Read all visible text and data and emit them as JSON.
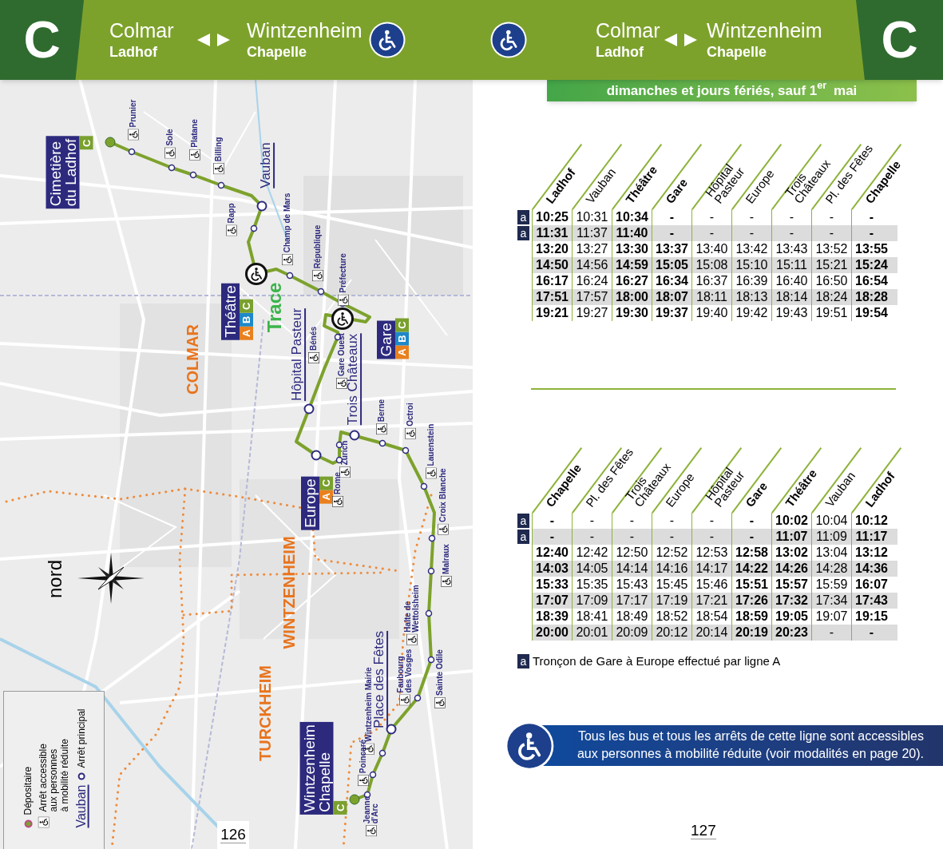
{
  "header": {
    "line_letters": [
      "C",
      "C"
    ],
    "sides": [
      {
        "from_city": "Colmar",
        "from_stop": "Ladhof",
        "to_city": "Wintzenheim",
        "to_stop": "Chapelle"
      },
      {
        "from_city": "Colmar",
        "from_stop": "Ladhof",
        "to_city": "Wintzenheim",
        "to_stop": "Chapelle"
      }
    ]
  },
  "map": {
    "main_stops": [
      {
        "name": "Cimetière\ndu Ladhof",
        "kind": "boxed",
        "lines": [
          {
            "letter": "C",
            "color": "#7aa02e"
          }
        ]
      },
      {
        "name": "Vauban",
        "kind": "underlined"
      },
      {
        "name": "Théâtre",
        "kind": "boxed",
        "lines": [
          {
            "letter": "A",
            "color": "#e8801e"
          },
          {
            "letter": "B",
            "color": "#1e88c8"
          },
          {
            "letter": "C",
            "color": "#7aa02e"
          }
        ]
      },
      {
        "name": "Hôpital Pasteur",
        "kind": "underlined"
      },
      {
        "name": "Trois Châteaux",
        "kind": "underlined"
      },
      {
        "name": "Gare",
        "kind": "boxed",
        "lines": [
          {
            "letter": "A",
            "color": "#e8801e"
          },
          {
            "letter": "B",
            "color": "#1e88c8"
          },
          {
            "letter": "C",
            "color": "#7aa02e"
          }
        ]
      },
      {
        "name": "Europe",
        "kind": "boxed",
        "lines": [
          {
            "letter": "A",
            "color": "#e8801e"
          },
          {
            "letter": "C",
            "color": "#7aa02e"
          }
        ]
      },
      {
        "name": "Place des Fêtes",
        "kind": "underlined"
      },
      {
        "name": "Wintzenheim\nChapelle",
        "kind": "boxed",
        "lines": [
          {
            "letter": "C",
            "color": "#7aa02e"
          }
        ]
      }
    ],
    "stops": [
      "Prunier",
      "Sole",
      "Platane",
      "Billing",
      "Rapp",
      "Champ de Mars",
      "République",
      "Préfecture",
      "Bénés",
      "Gare Ouest",
      "Berne",
      "Octroi",
      "Lauenstein",
      "Zurich",
      "Rome",
      "Croix Blanche",
      "Malraux",
      "Halte de\nWettolsheim",
      "Sainte Odile",
      "Faubourg\ndes Vosges",
      "Wintzenheim Mairie",
      "Poincaré",
      "Jeanne\nd'Arc"
    ],
    "towns": [
      "COLMAR",
      "WINTZENHEIM",
      "TURCKHEIM"
    ],
    "agency": "Trace",
    "compass": "nord",
    "legend": {
      "depot": "Dépositaire",
      "accessible": "Arrêt accessible\naux personnes\nà mobilité réduite",
      "sample": "Vauban",
      "main": "Arrêt principal"
    }
  },
  "day_banner": "dimanches et jours fériés, sauf 1$^{er}$ mai",
  "outbound": {
    "columns": [
      {
        "label": "Ladhof",
        "bold": true
      },
      {
        "label": "Vauban",
        "bold": false
      },
      {
        "label": "Théâtre",
        "bold": true
      },
      {
        "label": "Gare",
        "bold": true
      },
      {
        "label": "Hôpital\nPasteur",
        "bold": false
      },
      {
        "label": "Europe",
        "bold": false
      },
      {
        "label": "Trois\nChâteaux",
        "bold": false
      },
      {
        "label": "Pl. des Fêtes",
        "bold": false
      },
      {
        "label": "Chapelle",
        "bold": true
      }
    ],
    "rows": [
      {
        "note": "a",
        "shaded": false,
        "times": [
          "10:25",
          "10:31",
          "10:34",
          "-",
          "-",
          "-",
          "-",
          "-",
          "-"
        ]
      },
      {
        "note": "a",
        "shaded": true,
        "times": [
          "11:31",
          "11:37",
          "11:40",
          "-",
          "-",
          "-",
          "-",
          "-",
          "-"
        ]
      },
      {
        "shaded": false,
        "times": [
          "13:20",
          "13:27",
          "13:30",
          "13:37",
          "13:40",
          "13:42",
          "13:43",
          "13:52",
          "13:55"
        ]
      },
      {
        "shaded": true,
        "times": [
          "14:50",
          "14:56",
          "14:59",
          "15:05",
          "15:08",
          "15:10",
          "15:11",
          "15:21",
          "15:24"
        ]
      },
      {
        "shaded": false,
        "times": [
          "16:17",
          "16:24",
          "16:27",
          "16:34",
          "16:37",
          "16:39",
          "16:40",
          "16:50",
          "16:54"
        ]
      },
      {
        "shaded": true,
        "times": [
          "17:51",
          "17:57",
          "18:00",
          "18:07",
          "18:11",
          "18:13",
          "18:14",
          "18:24",
          "18:28"
        ]
      },
      {
        "shaded": false,
        "times": [
          "19:21",
          "19:27",
          "19:30",
          "19:37",
          "19:40",
          "19:42",
          "19:43",
          "19:51",
          "19:54"
        ]
      }
    ]
  },
  "return": {
    "columns": [
      {
        "label": "Chapelle",
        "bold": true
      },
      {
        "label": "Pl. des Fêtes",
        "bold": false
      },
      {
        "label": "Trois\nChâteaux",
        "bold": false
      },
      {
        "label": "Europe",
        "bold": false
      },
      {
        "label": "Hôpital\nPasteur",
        "bold": false
      },
      {
        "label": "Gare",
        "bold": true
      },
      {
        "label": "Théâtre",
        "bold": true
      },
      {
        "label": "Vauban",
        "bold": false
      },
      {
        "label": "Ladhof",
        "bold": true
      }
    ],
    "rows": [
      {
        "note": "a",
        "shaded": false,
        "times": [
          "-",
          "-",
          "-",
          "-",
          "-",
          "-",
          "10:02",
          "10:04",
          "10:12"
        ]
      },
      {
        "note": "a",
        "shaded": true,
        "times": [
          "-",
          "-",
          "-",
          "-",
          "-",
          "-",
          "11:07",
          "11:09",
          "11:17"
        ]
      },
      {
        "shaded": false,
        "times": [
          "12:40",
          "12:42",
          "12:50",
          "12:52",
          "12:53",
          "12:58",
          "13:02",
          "13:04",
          "13:12"
        ]
      },
      {
        "shaded": true,
        "times": [
          "14:03",
          "14:05",
          "14:14",
          "14:16",
          "14:17",
          "14:22",
          "14:26",
          "14:28",
          "14:36"
        ]
      },
      {
        "shaded": false,
        "times": [
          "15:33",
          "15:35",
          "15:43",
          "15:45",
          "15:46",
          "15:51",
          "15:57",
          "15:59",
          "16:07"
        ]
      },
      {
        "shaded": true,
        "times": [
          "17:07",
          "17:09",
          "17:17",
          "17:19",
          "17:21",
          "17:26",
          "17:32",
          "17:34",
          "17:43"
        ]
      },
      {
        "shaded": false,
        "times": [
          "18:39",
          "18:41",
          "18:49",
          "18:52",
          "18:54",
          "18:59",
          "19:05",
          "19:07",
          "19:15"
        ]
      },
      {
        "shaded": true,
        "times": [
          "20:00",
          "20:01",
          "20:09",
          "20:12",
          "20:14",
          "20:19",
          "20:23",
          "-",
          "-"
        ]
      }
    ]
  },
  "footnote": {
    "mark": "a",
    "text": "Tronçon de Gare à Europe effectué par ligne A"
  },
  "accessibility_note": "Tous les bus et tous les arrêts de cette ligne sont accessibles\naux personnes à mobilité réduite (voir modalités en page 20).",
  "page_numbers": [
    "126",
    "127"
  ]
}
